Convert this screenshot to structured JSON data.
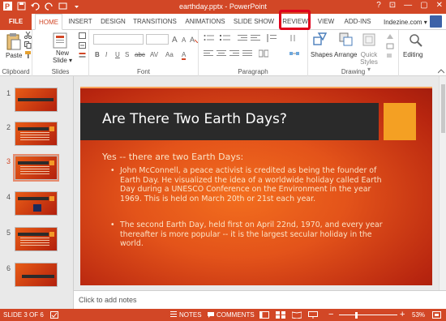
{
  "window": {
    "title": "earthday.pptx - PowerPoint",
    "controls": [
      "?",
      "—",
      "▢",
      "✕"
    ]
  },
  "tabs": {
    "file": "FILE",
    "items": [
      "HOME",
      "INSERT",
      "DESIGN",
      "TRANSITIONS",
      "ANIMATIONS",
      "SLIDE SHOW",
      "REVIEW",
      "VIEW",
      "ADD-INS"
    ],
    "active": "HOME",
    "highlighted": "REVIEW",
    "user": "Indezine.com ▾"
  },
  "ribbon": {
    "clipboard": {
      "label": "Clipboard",
      "paste": "Paste"
    },
    "slides": {
      "label": "Slides",
      "new_slide": "New Slide ▾"
    },
    "font": {
      "label": "Font",
      "buttons": [
        "B",
        "I",
        "U",
        "S",
        "abc",
        "AV",
        "Aa",
        "A"
      ]
    },
    "paragraph": {
      "label": "Paragraph"
    },
    "drawing": {
      "label": "Drawing",
      "shapes": "Shapes",
      "arrange": "Arrange",
      "quick_styles": "Quick Styles ▾"
    },
    "editing": {
      "label": "Editing"
    }
  },
  "thumbnails": [
    1,
    2,
    3,
    4,
    5,
    6
  ],
  "active_slide": 3,
  "slide": {
    "title": "Are There Two Earth Days?",
    "level1": "Yes -- there are two Earth Days:",
    "bullets": [
      "John McConnell, a peace activist is credited as being the founder of Earth Day. He visualized the idea of a worldwide holiday called Earth Day during a UNESCO Conference on the Environment in the year 1969. This is held on March 20th or 21st each year.",
      "The second Earth Day, held first on April 22nd, 1970, and every year thereafter is more popular -- it is the largest secular holiday in the world."
    ]
  },
  "notes_placeholder": "Click to add notes",
  "status": {
    "slide_info": "SLIDE 3 OF 6",
    "notes": "NOTES",
    "comments": "COMMENTS",
    "zoom": "53%"
  },
  "colors": {
    "accent": "#d24726",
    "review_highlight": "#e0001b",
    "slide_title_bar": "#2a2a2a",
    "slide_accent": "#f4a023"
  }
}
